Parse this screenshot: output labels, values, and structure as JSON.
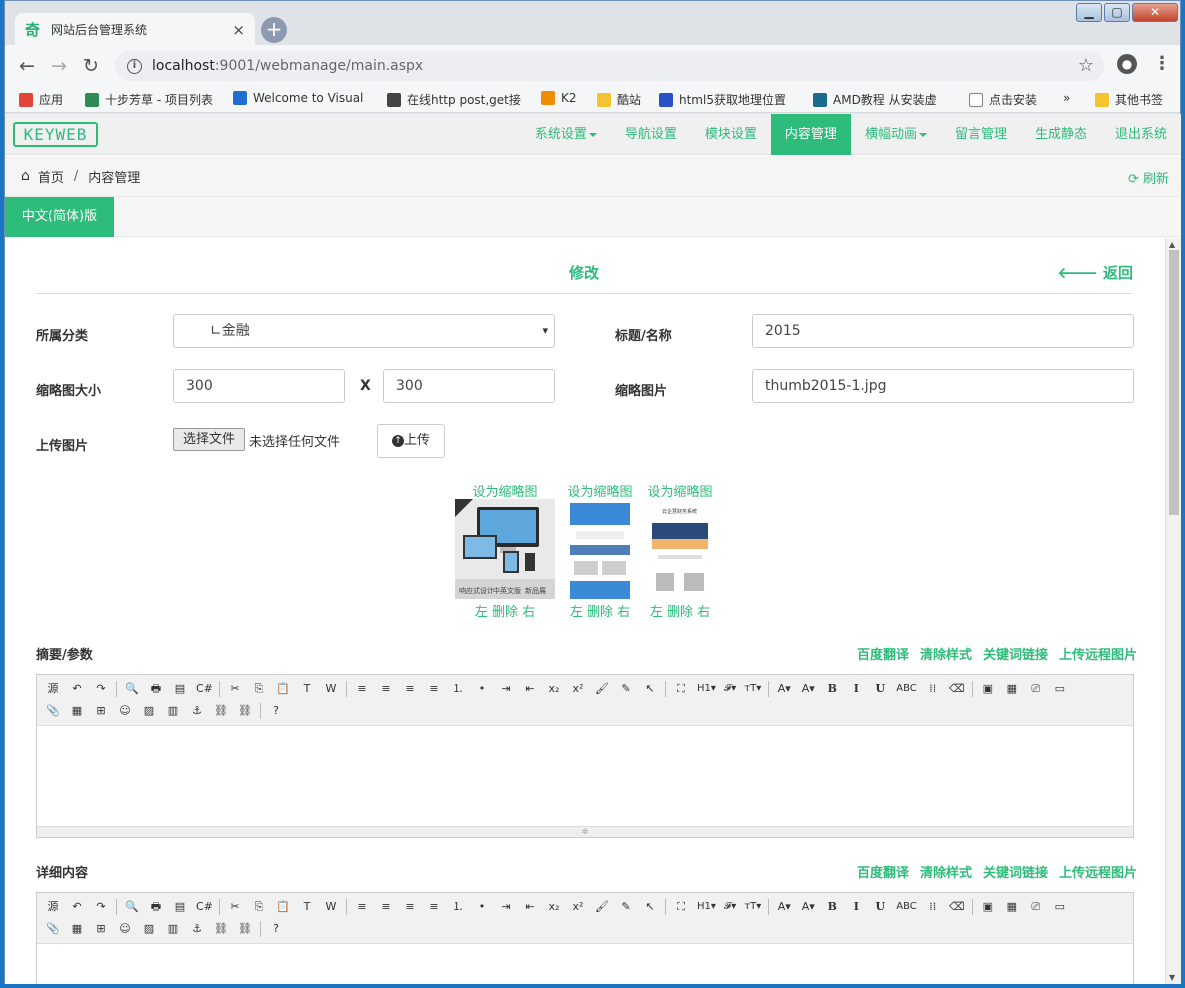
{
  "browser": {
    "tab_title": "网站后台管理系统",
    "url_host": "localhost",
    "url_rest": ":9001/webmanage/main.aspx",
    "bookmarks": [
      {
        "label": "应用",
        "color": "#e2443a"
      },
      {
        "label": "十步芳草 - 项目列表",
        "color": "#2e8b57"
      },
      {
        "label": "Welcome to Visual",
        "color": "#1f6fd1"
      },
      {
        "label": "在线http post,get接",
        "color": "#444444"
      },
      {
        "label": "K2",
        "color": "#f08c00"
      },
      {
        "label": "酷站",
        "color": "#f4c430"
      },
      {
        "label": "html5获取地理位置",
        "color": "#2b4fc7"
      },
      {
        "label": "AMD教程 从安装虚",
        "color": "#1b6b8f"
      },
      {
        "label": "点击安装",
        "color": "#888888"
      }
    ],
    "more": "»",
    "other_bookmarks": "其他书签"
  },
  "topnav": {
    "logo": "KEYWEB",
    "items": [
      {
        "label": "系统设置",
        "dropdown": true,
        "active": false
      },
      {
        "label": "导航设置",
        "dropdown": false,
        "active": false
      },
      {
        "label": "模块设置",
        "dropdown": false,
        "active": false
      },
      {
        "label": "内容管理",
        "dropdown": false,
        "active": true
      },
      {
        "label": "横幅动画",
        "dropdown": true,
        "active": false
      },
      {
        "label": "留言管理",
        "dropdown": false,
        "active": false
      },
      {
        "label": "生成静态",
        "dropdown": false,
        "active": false
      },
      {
        "label": "退出系统",
        "dropdown": false,
        "active": false
      }
    ]
  },
  "breadcrumb": {
    "home": "首页",
    "sep": "/",
    "current": "内容管理",
    "refresh": "刷新"
  },
  "lang_tab": "中文(简体)版",
  "form": {
    "title": "修改",
    "back": "返回",
    "category_label": "所属分类",
    "category_value": "∟金融",
    "title_label": "标题/名称",
    "title_value": "2015",
    "thumb_size_label": "缩略图大小",
    "thumb_w": "300",
    "thumb_x": "X",
    "thumb_h": "300",
    "thumb_img_label": "缩略图片",
    "thumb_img_value": "thumb2015-1.jpg",
    "upload_label": "上传图片",
    "file_button": "选择文件",
    "file_none": "未选择任何文件",
    "upload_button": "上传",
    "thumbs": [
      {
        "set": "设为缩略图",
        "left": "左",
        "delete": "删除",
        "right": "右"
      },
      {
        "set": "设为缩略图",
        "left": "左",
        "delete": "删除",
        "right": "右"
      },
      {
        "set": "设为缩略图",
        "left": "左",
        "delete": "删除",
        "right": "右"
      }
    ],
    "thumb_overlay": [
      "响应式设计",
      "中英文版",
      "新品展"
    ],
    "thumb3_title": "云企慧财务系统",
    "summary_label": "摘要/参数",
    "detail_label": "详细内容",
    "tools": [
      "百度翻译",
      "清除样式",
      "关键词链接",
      "上传远程图片"
    ]
  },
  "editor_toolbar_row1": [
    "源",
    "↶",
    "↷",
    "|",
    "🔍",
    "🖶",
    "▤",
    "C#",
    "|",
    "✂",
    "⎘",
    "📋",
    "T",
    "W",
    "|",
    "≡",
    "≡",
    "≡",
    "≡",
    "⒈",
    "•",
    "⇥",
    "⇤",
    "x₂",
    "x²",
    "🖌",
    "✎",
    "↖",
    "|",
    "⛶",
    "H1▾",
    "𝓕▾",
    "тT▾",
    "|",
    "A▾",
    "A▾",
    "B",
    "I",
    "U",
    "ABC",
    "⁞⁞",
    "⌫",
    "|",
    "▣",
    "▦",
    "⎚",
    "▭"
  ],
  "editor_toolbar_row2": [
    "📎",
    "▦",
    "⊞",
    "☺",
    "▨",
    "▥",
    "⚓",
    "⛓",
    "⛓",
    "|",
    "?"
  ],
  "colors": {
    "accent": "#2ebc7b"
  }
}
